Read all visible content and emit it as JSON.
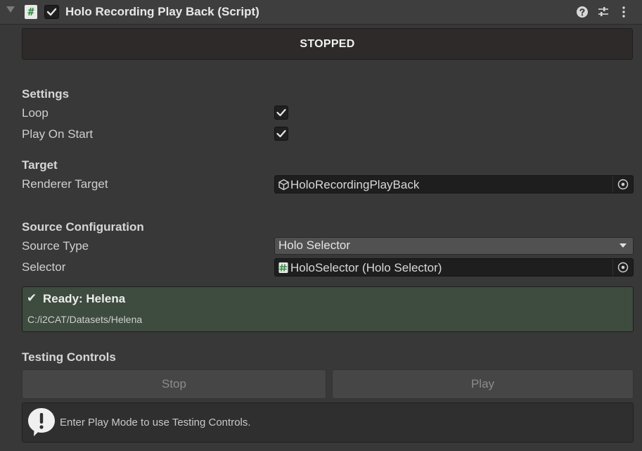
{
  "component": {
    "title": "Holo Recording Play Back (Script)",
    "script_glyph": "#",
    "enabled": true
  },
  "header_icons": [
    "help-icon",
    "presets-icon",
    "kebab-menu-icon"
  ],
  "status": {
    "text": "STOPPED"
  },
  "settings": {
    "header": "Settings",
    "loop_label": "Loop",
    "loop_checked": true,
    "play_on_start_label": "Play On Start",
    "play_on_start_checked": true
  },
  "target": {
    "header": "Target",
    "renderer_target_label": "Renderer Target",
    "renderer_target_value": "HoloRecordingPlayBack",
    "renderer_target_icon": "gameobject-cube-icon"
  },
  "source": {
    "header": "Source Configuration",
    "source_type_label": "Source Type",
    "source_type_value": "Holo Selector",
    "selector_label": "Selector",
    "selector_value": "HoloSelector (Holo Selector)",
    "selector_icon": "script-icon"
  },
  "ready": {
    "check_glyph": "✔",
    "title": "Ready: Helena",
    "path": "C:/i2CAT/Datasets/Helena"
  },
  "testing": {
    "header": "Testing Controls",
    "stop_label": "Stop",
    "play_label": "Play",
    "help_text": "Enter Play Mode to use Testing Controls."
  },
  "colors": {
    "panel_bg": "#383838",
    "ready_bg": "#3e4b3f",
    "field_bg": "#1e1e1e",
    "script_icon_green": "#2e8f3e"
  }
}
